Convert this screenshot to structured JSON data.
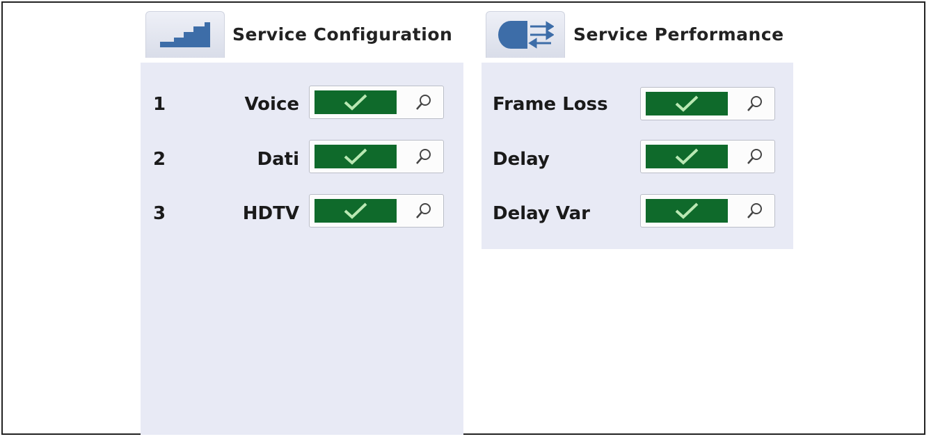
{
  "config": {
    "title": "Service Configuration",
    "header_icon": "staircase-bars-icon",
    "services": [
      {
        "number": "1",
        "name": "Voice",
        "status": "pass"
      },
      {
        "number": "2",
        "name": "Dati",
        "status": "pass"
      },
      {
        "number": "3",
        "name": "HDTV",
        "status": "pass"
      }
    ]
  },
  "performance": {
    "title": "Service Performance",
    "header_icon": "pipe-arrows-icon",
    "metrics": [
      {
        "name": "Frame Loss",
        "status": "pass"
      },
      {
        "name": "Delay",
        "status": "pass"
      },
      {
        "name": "Delay Var",
        "status": "pass"
      }
    ]
  },
  "icons": {
    "pass": "checkmark-icon",
    "details": "magnifier-icon"
  },
  "colors": {
    "pass_fill": "#0f6a2b",
    "check": "#b9e8b3",
    "panel": "#e8eaf5",
    "header_icon": "#3d6da8"
  }
}
